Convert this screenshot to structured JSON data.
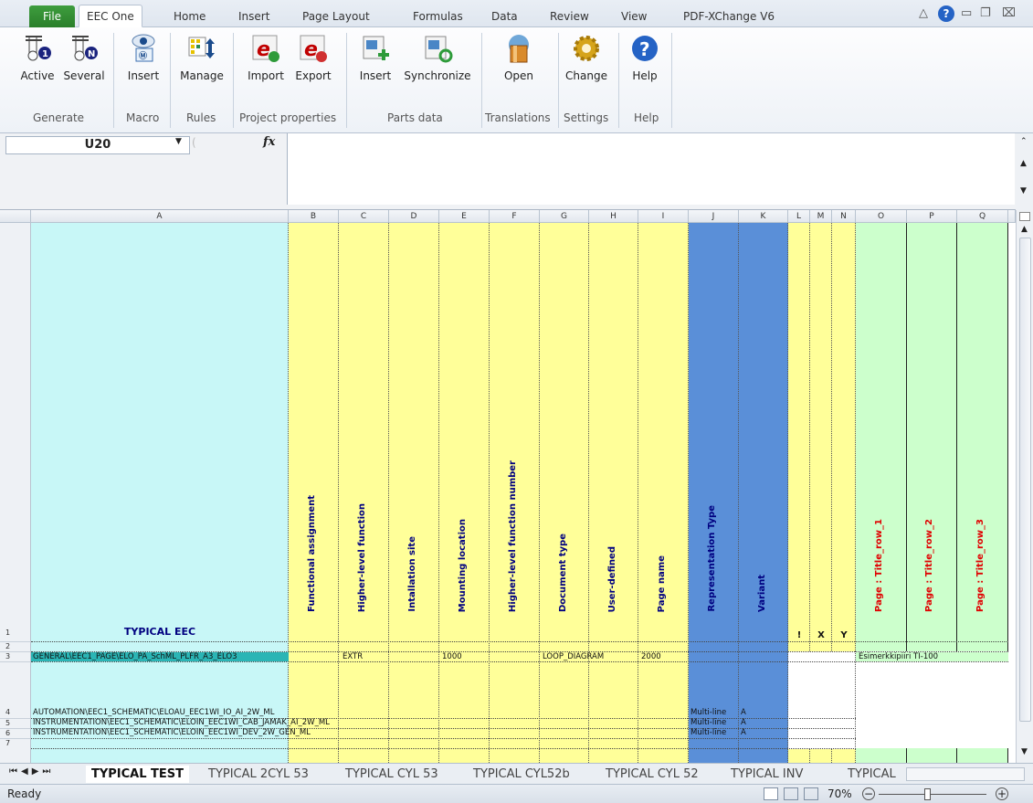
{
  "ribbon_tabs": [
    {
      "label": "File"
    },
    {
      "label": "EEC One"
    },
    {
      "label": "Home"
    },
    {
      "label": "Insert"
    },
    {
      "label": "Page Layout"
    },
    {
      "label": "Formulas"
    },
    {
      "label": "Data"
    },
    {
      "label": "Review"
    },
    {
      "label": "View"
    },
    {
      "label": "PDF-XChange V6"
    }
  ],
  "ribbon_buttons": {
    "active": "Active",
    "several": "Several",
    "macro_insert": "Insert",
    "manage": "Manage",
    "import": "Import",
    "export": "Export",
    "parts_insert": "Insert",
    "synchronize": "Synchronize",
    "open": "Open",
    "change": "Change",
    "help": "Help"
  },
  "ribbon_groups": {
    "generate": "Generate",
    "macro": "Macro",
    "rules": "Rules",
    "project_properties": "Project properties",
    "parts_data": "Parts data",
    "translations": "Translations",
    "settings": "Settings",
    "help": "Help"
  },
  "formula_bar": {
    "name_box": "U20",
    "fx": "fx",
    "content": ""
  },
  "columns": [
    "A",
    "B",
    "C",
    "D",
    "E",
    "F",
    "G",
    "H",
    "I",
    "J",
    "K",
    "L",
    "M",
    "N",
    "O",
    "P",
    "Q"
  ],
  "rows": [
    "1",
    "2",
    "3",
    "4",
    "5",
    "6",
    "7"
  ],
  "header_cells": {
    "a1": "TYPICAL EEC",
    "b1": "Functional assignment",
    "c1": "Higher-level function",
    "d1": "Intallation site",
    "e1": "Mounting location",
    "f1": "Higher-level function number",
    "g1": "Document type",
    "h1": "User-defined",
    "i1": "Page name",
    "j1": "Representation Type",
    "k1": "Variant",
    "l1": "!",
    "m1": "X",
    "n1": "Y",
    "o1": "Page : Title_row_1",
    "p1": "Page : Title_row_2",
    "q1": "Page : Title_row_3"
  },
  "row3": {
    "a": "GENERAL\\EEC1_PAGE\\ELO_PA_SchML_PLFR_A3_ELO3",
    "c": "EXTR",
    "e": "1000",
    "g": "LOOP_DIAGRAM",
    "i": "2000",
    "o": "Esimerkkipiiri TI-100"
  },
  "row4": {
    "a": "AUTOMATION\\EEC1_SCHEMATIC\\ELOAU_EEC1WI_IO_AI_2W_ML",
    "j": "Multi-line",
    "k": "A"
  },
  "row5": {
    "a": "INSTRUMENTATION\\EEC1_SCHEMATIC\\ELOIN_EEC1WI_CAB_JAMAK_AI_2W_ML",
    "j": "Multi-line",
    "k": "A"
  },
  "row6": {
    "a": "INSTRUMENTATION\\EEC1_SCHEMATIC\\ELOIN_EEC1WI_DEV_2W_GEN_ML",
    "j": "Multi-line",
    "k": "A"
  },
  "sheet_tabs": [
    "TYPICAL TEST",
    "TYPICAL 2CYL 53",
    "TYPICAL CYL 53",
    "TYPICAL CYL52b",
    "TYPICAL CYL 52",
    "TYPICAL INV",
    "TYPICAL"
  ],
  "status": {
    "mode": "Ready",
    "zoom": "70%"
  },
  "colors": {
    "cyan": "#c8f7f7",
    "yellow": "#ffff99",
    "blue": "#5a8fd8",
    "green": "#ccffcc",
    "red_text": "#e00000",
    "navy_text": "#000080"
  }
}
